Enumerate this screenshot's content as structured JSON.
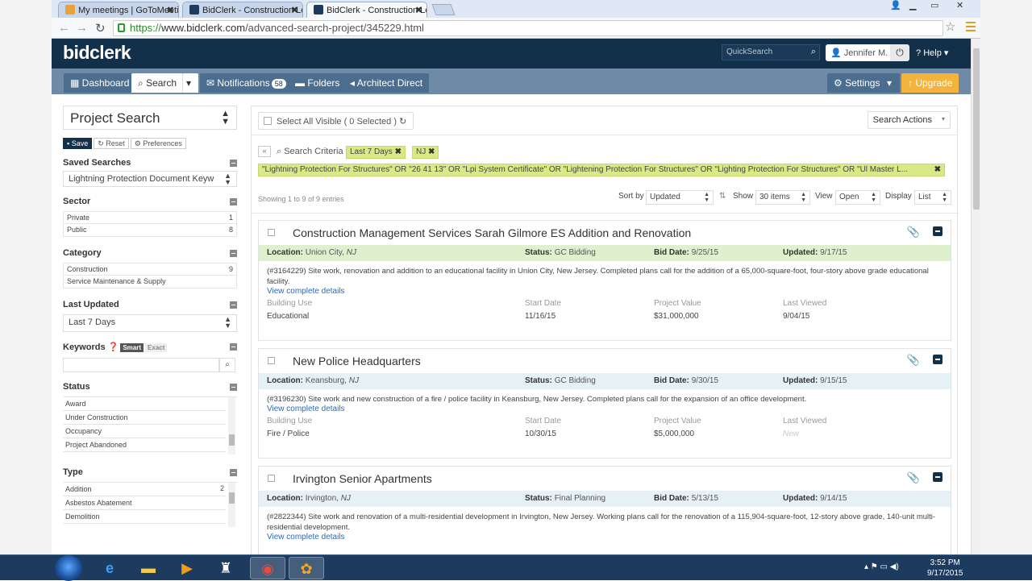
{
  "browser": {
    "tabs": [
      {
        "label": "My meetings | GoToMeeti",
        "fav_color": "#e8a23c",
        "active": false
      },
      {
        "label": "BidClerk - Construction Le",
        "fav_color": "#1d3b5e",
        "active": false
      },
      {
        "label": "BidClerk - Construction Le",
        "fav_color": "#1d3b5e",
        "active": true
      }
    ],
    "url_scheme": "https://",
    "url_host": "www.bidclerk.com",
    "url_path": "/advanced-search-project/345229.html"
  },
  "header": {
    "logo": "bidclerk",
    "quicksearch_placeholder": "QuickSearch",
    "user": "Jennifer M.",
    "help": "Help"
  },
  "nav": {
    "dashboard": "Dashboard",
    "search": "Search",
    "notifications": "Notifications",
    "notifications_count": "58",
    "folders": "Folders",
    "architect": "Architect Direct",
    "settings": "Settings",
    "upgrade": "Upgrade"
  },
  "sidebar": {
    "project_search": "Project Search",
    "save": "Save",
    "reset": "Reset",
    "preferences": "Preferences",
    "saved_searches_title": "Saved Searches",
    "saved_search_value": "Lightning Protection Document Keyw",
    "sector_title": "Sector",
    "sector": [
      {
        "label": "Private",
        "count": "1"
      },
      {
        "label": "Public",
        "count": "8"
      }
    ],
    "category_title": "Category",
    "category": [
      {
        "label": "Construction",
        "count": "9"
      },
      {
        "label": "Service Maintenance & Supply",
        "count": ""
      }
    ],
    "last_updated_title": "Last Updated",
    "last_updated_value": "Last 7 Days",
    "keywords_title": "Keywords",
    "smart": "Smart",
    "exact": "Exact",
    "status_title": "Status",
    "status": [
      "Award",
      "Under Construction",
      "Occupancy",
      "Project Abandoned"
    ],
    "type_title": "Type",
    "type": [
      {
        "label": "Addition",
        "count": "2"
      },
      {
        "label": "Asbestos Abatement",
        "count": ""
      },
      {
        "label": "Demolition",
        "count": ""
      }
    ]
  },
  "main": {
    "select_all": "Select All Visible ( 0 Selected )",
    "search_actions": "Search Actions",
    "criteria_label": "Search Criteria",
    "chips": [
      "Last 7 Days",
      "NJ"
    ],
    "keyword_chip": "\"Lightning Protection For Structures\" OR \"26 41 13\" OR \"Lpi System Certificate\" OR \"Lightening Protection For Structures\" OR \"Lighting Protection For Structures\" OR \"Ul Master L...",
    "showing": "Showing 1 to 9 of 9 entries",
    "sort_by_label": "Sort by",
    "sort_by": "Updated",
    "show_label": "Show",
    "show": "30 items",
    "view_label": "View",
    "view": "Open",
    "display_label": "Display",
    "display": "List"
  },
  "labels": {
    "location": "Location:",
    "status": "Status:",
    "bid_date": "Bid Date:",
    "updated": "Updated:",
    "view_details": "View complete details",
    "building_use": "Building Use",
    "start_date": "Start Date",
    "project_value": "Project Value",
    "last_viewed": "Last Viewed"
  },
  "projects": [
    {
      "title": "Construction Management Services Sarah Gilmore ES Addition and Renovation",
      "city": "Union City, ",
      "state": "NJ",
      "status": "GC Bidding",
      "bid_date": "9/25/15",
      "updated": "9/17/15",
      "desc": "(#3164229) Site work, renovation and addition to an educational facility in Union City, New Jersey. Completed plans call for the addition of a 65,000-square-foot, four-story above grade educational facility.",
      "building_use": "Educational",
      "start_date": "11/16/15",
      "value": "$31,000,000",
      "last_viewed": "9/04/15"
    },
    {
      "title": "New Police Headquarters",
      "city": "Keansburg, ",
      "state": "NJ",
      "status": "GC Bidding",
      "bid_date": "9/30/15",
      "updated": "9/15/15",
      "desc": "(#3196230) Site work and new construction of a fire / police facility in Keansburg, New Jersey. Completed plans call for the expansion of an office development.",
      "building_use": "Fire / Police",
      "start_date": "10/30/15",
      "value": "$5,000,000",
      "last_viewed": "New"
    },
    {
      "title": "Irvington Senior Apartments",
      "city": "Irvington, ",
      "state": "NJ",
      "status": "Final Planning",
      "bid_date": "5/13/15",
      "updated": "9/14/15",
      "desc": "(#2822344) Site work and renovation of a multi-residential development in Irvington, New Jersey. Working plans call for the renovation of a 115,904-square-foot, 12-story above grade, 140-unit multi-residential development."
    }
  ],
  "taskbar": {
    "time": "3:52 PM",
    "date": "9/17/2015"
  }
}
